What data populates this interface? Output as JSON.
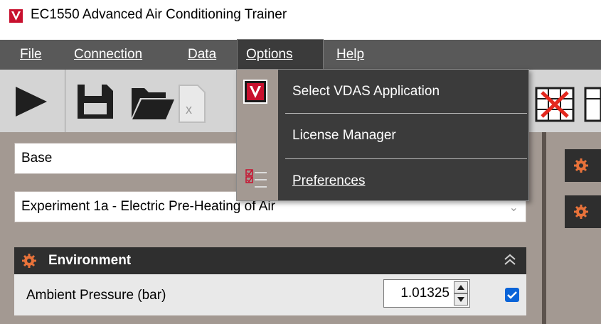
{
  "window": {
    "title": "EC1550 Advanced Air Conditioning Trainer",
    "brand_color": "#c8102e"
  },
  "menu": {
    "file": "File",
    "connection": "Connection",
    "data": "Data",
    "options": "Options",
    "help": "Help"
  },
  "options_menu": {
    "items": [
      {
        "label": "Select VDAS Application",
        "icon": "vdas-logo-icon"
      },
      {
        "label": "License Manager",
        "icon": ""
      },
      {
        "label": "Preferences",
        "icon": "preferences-checklist-icon"
      }
    ]
  },
  "toolbar": {
    "icons": [
      "play-icon",
      "save-icon",
      "open-folder-icon",
      "export-excel-icon",
      "clear-grid-icon"
    ]
  },
  "left": {
    "base_field": "Base",
    "experiment_select": "Experiment 1a - Electric Pre-Heating of Air",
    "environment": {
      "title": "Environment",
      "rows": [
        {
          "label": "Ambient Pressure (bar)",
          "value": "1.01325",
          "checked": true
        }
      ]
    }
  }
}
